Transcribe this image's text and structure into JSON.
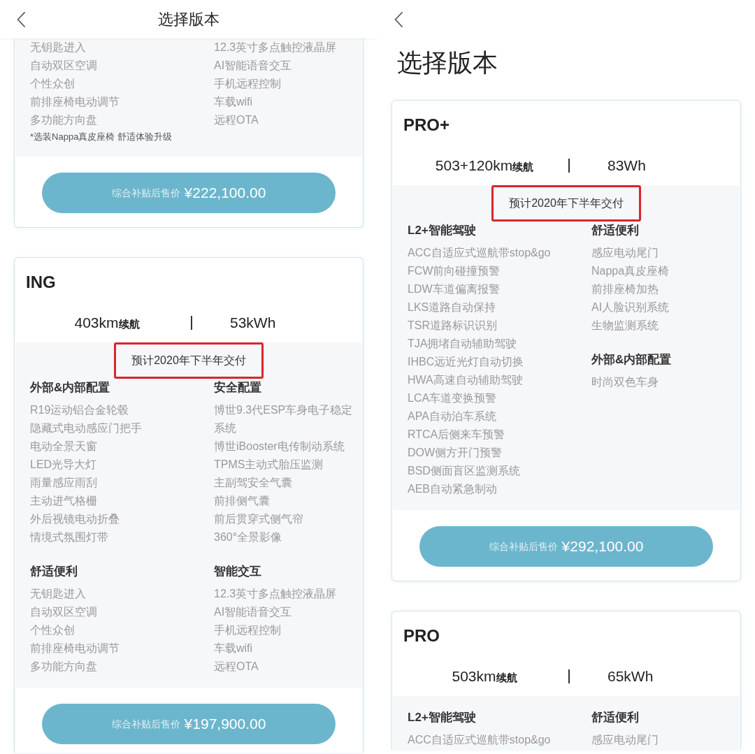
{
  "panels": [
    {
      "kind": "bar",
      "title": "选择版本",
      "cards": [
        {
          "feature_columns": [
            {
              "sections": [
                {
                  "items": [
                    "无钥匙进入",
                    "自动双区空调",
                    "个性众创",
                    "前排座椅电动调节",
                    "多功能方向盘"
                  ]
                }
              ]
            },
            {
              "sections": [
                {
                  "items": [
                    "12.3英寸多点触控液晶屏",
                    "AI智能语音交互",
                    "手机远程控制",
                    "车载wifi",
                    "远程OTA"
                  ]
                }
              ]
            }
          ],
          "note": "*选装Nappa真皮座椅 舒适体验升级",
          "price_label": "综合补贴后售价",
          "price": "¥222,100.00"
        },
        {
          "name": "ING",
          "range": "403km",
          "range_unit": "续航",
          "battery": "53kWh",
          "delivery": {
            "text": "预计2020年下半年交付",
            "marked": true
          },
          "feature_columns": [
            {
              "sections": [
                {
                  "title": "外部&内部配置",
                  "items": [
                    "R19运动铝合金轮毂",
                    "隐藏式电动感应门把手",
                    "电动全景天窗",
                    "LED光导大灯",
                    "雨量感应雨刮",
                    "主动进气格栅",
                    "外后视镜电动折叠",
                    "情境式氛围灯带"
                  ]
                },
                {
                  "title": "舒适便利",
                  "items": [
                    "无钥匙进入",
                    "自动双区空调",
                    "个性众创",
                    "前排座椅电动调节",
                    "多功能方向盘"
                  ]
                }
              ]
            },
            {
              "sections": [
                {
                  "title": "安全配置",
                  "items": [
                    "博世9.3代ESP车身电子稳定系统",
                    "博世iBooster电传制动系统",
                    "TPMS主动式胎压监测",
                    "主副驾安全气囊",
                    "前排侧气囊",
                    "前后贯穿式侧气帘",
                    "360°全景影像"
                  ]
                },
                {
                  "title": "智能交互",
                  "items": [
                    "12.3英寸多点触控液晶屏",
                    "AI智能语音交互",
                    "手机远程控制",
                    "车载wifi",
                    "远程OTA"
                  ]
                }
              ]
            }
          ],
          "price_label": "综合补贴后售价",
          "price": "¥197,900.00"
        }
      ]
    },
    {
      "kind": "large",
      "title": "选择版本",
      "cards": [
        {
          "name": "PRO+",
          "range": "503+120km",
          "range_unit": "续航",
          "battery": "83Wh",
          "delivery": {
            "text": "预计2020年下半年交付",
            "marked": true
          },
          "feature_columns": [
            {
              "sections": [
                {
                  "title": "L2+智能驾驶",
                  "items": [
                    "ACC自适应式巡航带stop&go",
                    "FCW前向碰撞预警",
                    "LDW车道偏离报警",
                    "LKS道路自动保持",
                    "TSR道路标识识别",
                    "TJA拥堵自动辅助驾驶",
                    "IHBC远近光灯自动切换",
                    "HWA高速自动辅助驾驶",
                    "LCA车道变换预警",
                    "APA自动泊车系统",
                    "RTCA后侧来车预警",
                    "DOW侧方开门预警",
                    "BSD侧面盲区监测系统",
                    "AEB自动紧急制动"
                  ]
                }
              ]
            },
            {
              "sections": [
                {
                  "title": "舒适便利",
                  "items": [
                    "感应电动尾门",
                    "Nappa真皮座椅",
                    "前排座椅加热",
                    "AI人脸识别系统",
                    "生物监测系统"
                  ]
                },
                {
                  "title": "外部&内部配置",
                  "items": [
                    "时尚双色车身"
                  ]
                }
              ]
            }
          ],
          "price_label": "综合补贴后售价",
          "price": "¥292,100.00"
        },
        {
          "name": "PRO",
          "range": "503km",
          "range_unit": "续航",
          "battery": "65kWh",
          "feature_columns": [
            {
              "sections": [
                {
                  "title": "L2+智能驾驶",
                  "items": [
                    "ACC自适应式巡航带stop&go"
                  ]
                }
              ]
            },
            {
              "sections": [
                {
                  "title": "舒适便利",
                  "items": [
                    "感应电动尾门"
                  ]
                }
              ]
            }
          ]
        }
      ]
    }
  ]
}
